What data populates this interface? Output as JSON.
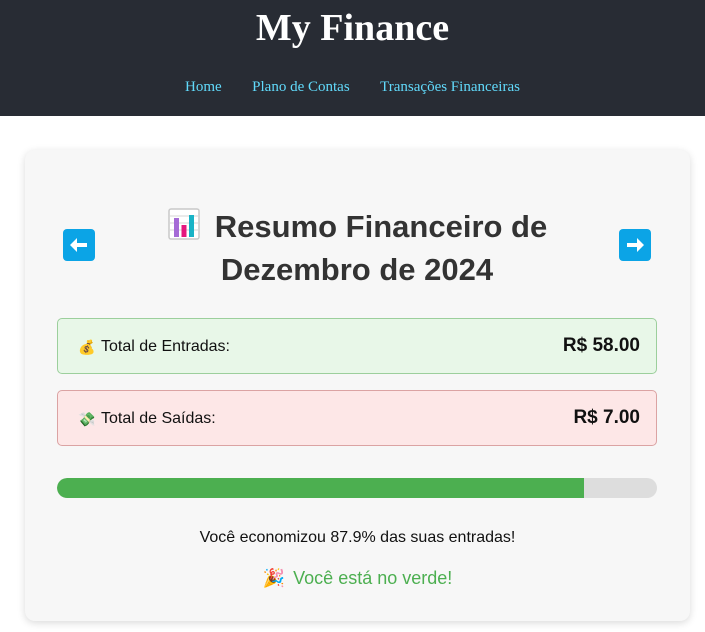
{
  "header": {
    "brand": "My Finance",
    "nav": [
      {
        "label": "Home"
      },
      {
        "label": "Plano de Contas"
      },
      {
        "label": "Transações Financeiras"
      }
    ]
  },
  "summary": {
    "title_line1": "Resumo Financeiro de",
    "title_line2": "Dezembro de 2024",
    "title_icon": "bar-chart-icon",
    "prev_icon": "left-arrow-icon",
    "next_icon": "right-arrow-icon",
    "income": {
      "icon": "money-bag-icon",
      "label": "Total de Entradas:",
      "value": "R$ 58.00"
    },
    "expenses": {
      "icon": "money-wings-icon",
      "label": "Total de Saídas:",
      "value": "R$ 7.00"
    },
    "savings_percent": 87.9,
    "savings_text": "Você economizou 87.9% das suas entradas!",
    "status_icon": "party-popper-icon",
    "status_text": "Você está no verde!"
  },
  "colors": {
    "header_bg": "#282c34",
    "nav_link": "#61dafb",
    "arrow_button": "#0ba4e6",
    "progress_fill": "#4caf50",
    "progress_track": "#dddddd",
    "status_text": "#4caf50"
  }
}
